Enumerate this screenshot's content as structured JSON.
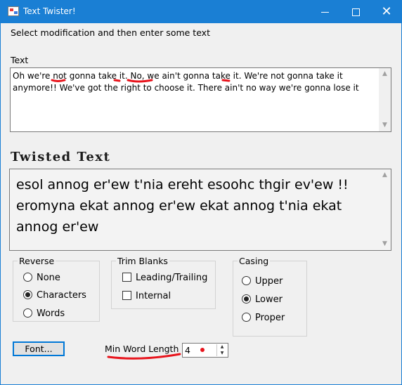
{
  "window": {
    "title": "Text Twister!",
    "minimize_symbol": "—",
    "maximize_symbol": "☐",
    "close_symbol": "✕",
    "accent_color": "#1a7fd4"
  },
  "instruction": "Select modification  and then enter some text",
  "input": {
    "label": "Text",
    "value": "Oh we're not gonna take it. No, we ain't gonna take it. We're not gonna take it anymore!! We've got the right to choose it. There ain't no way we're gonna lose it"
  },
  "output": {
    "title": "Twisted Text",
    "value": "esol annog er'ew t'nia ereht esoohc thgir ev'ew !! eromyna ekat annog er'ew ekat annog t'nia ekat annog er'ew"
  },
  "reverse": {
    "legend": "Reverse",
    "options": [
      {
        "label": "None",
        "checked": false
      },
      {
        "label": "Characters",
        "checked": true
      },
      {
        "label": "Words",
        "checked": false
      }
    ]
  },
  "trim": {
    "legend": "Trim Blanks",
    "options": [
      {
        "label": "Leading/Trailing",
        "checked": false
      },
      {
        "label": "Internal",
        "checked": false
      }
    ]
  },
  "casing": {
    "legend": "Casing",
    "options": [
      {
        "label": "Upper",
        "checked": false
      },
      {
        "label": "Lower",
        "checked": true
      },
      {
        "label": "Proper",
        "checked": false
      }
    ]
  },
  "font_button": "Font...",
  "min_word_length": {
    "label": "Min Word Length",
    "value": "4"
  },
  "annotation_color": "#e8141c"
}
